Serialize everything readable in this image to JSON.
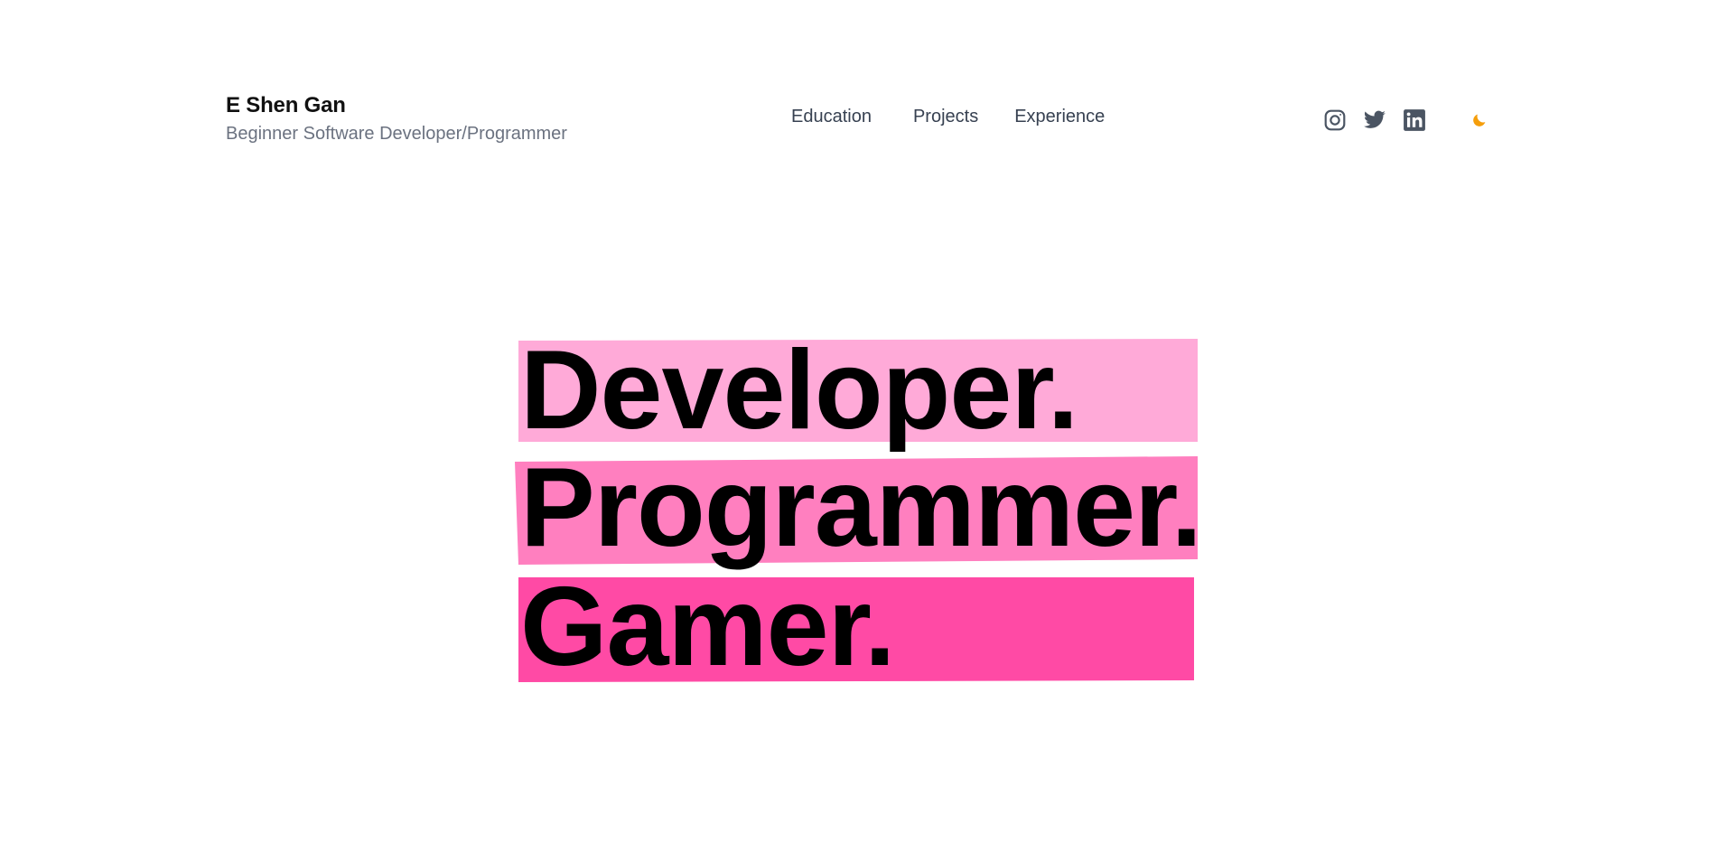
{
  "header": {
    "name": "E Shen Gan",
    "tagline": "Beginner Software Developer/Programmer"
  },
  "nav": {
    "items": [
      {
        "label": "Education"
      },
      {
        "label": "Projects"
      },
      {
        "label": "Experience"
      }
    ]
  },
  "social": {
    "icons": [
      "instagram-icon",
      "twitter-icon",
      "linkedin-icon"
    ],
    "theme_icon": "moon-icon",
    "icon_color": "#4b5563",
    "theme_color": "#f59e0b"
  },
  "hero": {
    "lines": [
      {
        "text": "Developer.",
        "color": "#ffaad8"
      },
      {
        "text": "Programmer.",
        "color": "#ff7fbf"
      },
      {
        "text": "Gamer.",
        "color": "#ff4aa5"
      }
    ]
  }
}
